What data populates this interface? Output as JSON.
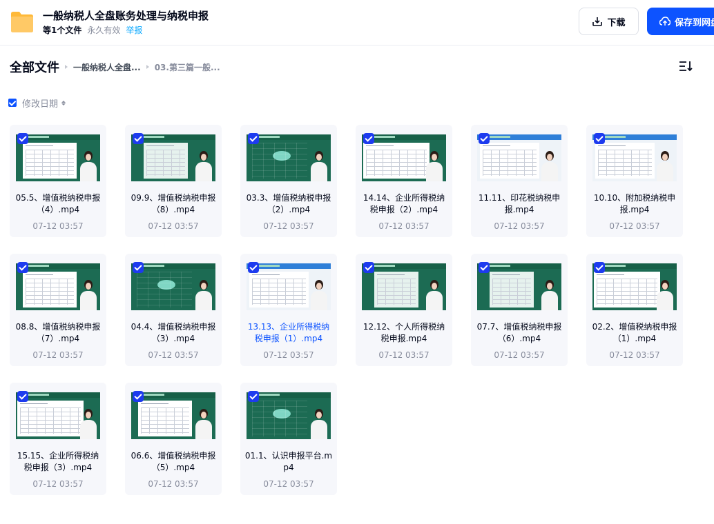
{
  "share": {
    "title": "一般纳税人全盘账务处理与纳税申报",
    "file_count": "等1个文件",
    "validity": "永久有效",
    "report": "举报"
  },
  "actions": {
    "download": "下载",
    "save": "保存到网盘"
  },
  "breadcrumb": {
    "root": "全部文件",
    "level1": "一般纳税人全盘...",
    "level2": "03.第三篇一般..."
  },
  "sort": {
    "label": "修改日期"
  },
  "files": [
    {
      "name": "05.5、增值税纳税申报（4）.mp4",
      "date": "07-12 03:57",
      "thumb": "style-a"
    },
    {
      "name": "09.9、增值税纳税申报（8）.mp4",
      "date": "07-12 03:57",
      "thumb": "style-b"
    },
    {
      "name": "03.3、增值税纳税申报（2）.mp4",
      "date": "07-12 03:57",
      "thumb": "style-d"
    },
    {
      "name": "14.14、企业所得税纳税申报（2）.mp4",
      "date": "07-12 03:57",
      "thumb": "style-c"
    },
    {
      "name": "11.11、印花税纳税申报.mp4",
      "date": "07-12 03:57",
      "thumb": "style-e"
    },
    {
      "name": "10.10、附加税纳税申报.mp4",
      "date": "07-12 03:57",
      "thumb": "style-e"
    },
    {
      "name": "08.8、增值税纳税申报（7）.mp4",
      "date": "07-12 03:57",
      "thumb": "style-a"
    },
    {
      "name": "04.4、增值税纳税申报（3）.mp4",
      "date": "07-12 03:57",
      "thumb": "style-d"
    },
    {
      "name": "13.13、企业所得税纳税申报（1）.mp4",
      "date": "07-12 03:57",
      "thumb": "style-e",
      "active": true
    },
    {
      "name": "12.12、个人所得税纳税申报.mp4",
      "date": "07-12 03:57",
      "thumb": "style-b"
    },
    {
      "name": "07.7、增值税纳税申报（6）.mp4",
      "date": "07-12 03:57",
      "thumb": "style-b"
    },
    {
      "name": "02.2、增值税纳税申报（1）.mp4",
      "date": "07-12 03:57",
      "thumb": "style-c"
    },
    {
      "name": "15.15、企业所得税纳税申报（3）.mp4",
      "date": "07-12 03:57",
      "thumb": "style-c"
    },
    {
      "name": "06.6、增值税纳税申报（5）.mp4",
      "date": "07-12 03:57",
      "thumb": "style-a"
    },
    {
      "name": "01.1、认识申报平台.mp4",
      "date": "07-12 03:57",
      "thumb": "style-d"
    }
  ],
  "colors": {
    "primary": "#0d53ff",
    "check": "#1d3bef",
    "link": "#06a7ff",
    "muted": "#878c9c",
    "card_bg": "#f6f7fb",
    "folder": "#ffc54d"
  }
}
